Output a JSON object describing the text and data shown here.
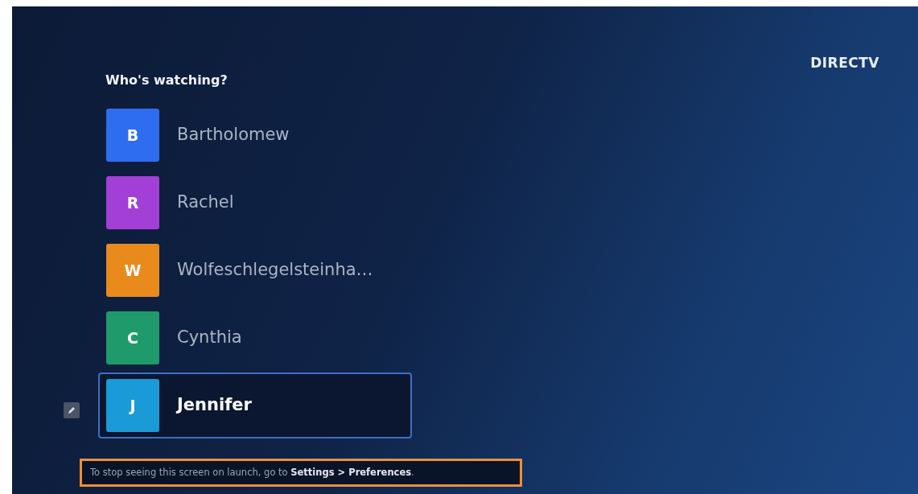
{
  "brand": "DIRECTV",
  "title": "Who's watching?",
  "profiles": [
    {
      "initial": "B",
      "name": "Bartholomew",
      "color": "#2f6df0",
      "selected": false
    },
    {
      "initial": "R",
      "name": "Rachel",
      "color": "#a23fd6",
      "selected": false
    },
    {
      "initial": "W",
      "name": "Wolfeschlegelsteinha…",
      "color": "#e88a1c",
      "selected": false
    },
    {
      "initial": "C",
      "name": "Cynthia",
      "color": "#1f9a6a",
      "selected": false
    },
    {
      "initial": "J",
      "name": "Jennifer",
      "color": "#1a9ad6",
      "selected": true
    }
  ],
  "footnote": "To stop seeing this screen on launch, go to **Settings > Preferences**."
}
